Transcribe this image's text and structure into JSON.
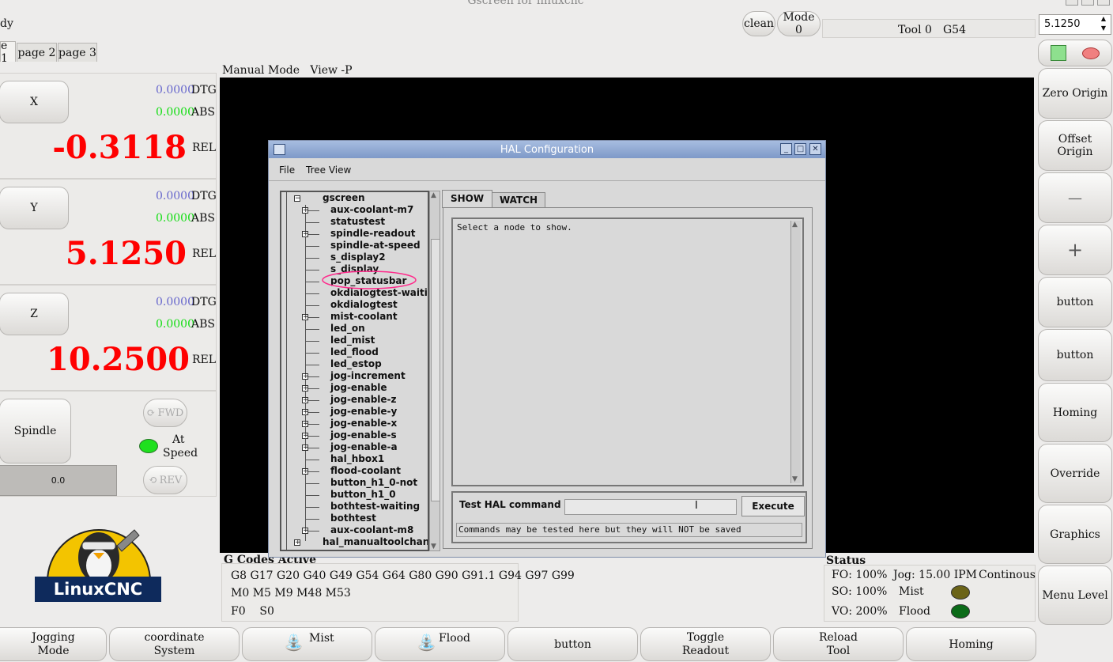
{
  "window_title": "Gscreen for linuxcnc",
  "status_left": "dy",
  "top": {
    "clean_label": "clean",
    "mode_label": "Mode 0",
    "tool_label": "Tool 0",
    "offset_label": "G54",
    "spin_value": "5.1250"
  },
  "tabs": [
    "e 1",
    "page 2",
    "page 3"
  ],
  "axes": [
    {
      "name": "X",
      "dtg": "0.0000",
      "abs": "0.0000",
      "rel": "-0.3118",
      "dtg_label": "DTG",
      "abs_label": "ABS",
      "rel_label": "REL"
    },
    {
      "name": "Y",
      "dtg": "0.0000",
      "abs": "0.0000",
      "rel": "5.1250",
      "dtg_label": "DTG",
      "abs_label": "ABS",
      "rel_label": "REL"
    },
    {
      "name": "Z",
      "dtg": "0.0000",
      "abs": "0.0000",
      "rel": "10.2500",
      "dtg_label": "DTG",
      "abs_label": "ABS",
      "rel_label": "REL"
    }
  ],
  "spindle": {
    "button_label": "Spindle",
    "fwd_label": "FWD",
    "rev_label": "REV",
    "at_label": "At",
    "speed_label": "Speed",
    "speed_value": "0.0"
  },
  "logo_text": "LinuxCNC",
  "graphics_header": "Manual Mode   View -P",
  "gcodes": {
    "title": "G Codes Active",
    "line1": "G8 G17 G20 G40 G49 G54 G64 G80 G90 G91.1 G94 G97 G99",
    "line2": "M0 M5 M9 M48 M53",
    "line3": "F0    S0"
  },
  "status": {
    "title": "Status",
    "fo": "FO: 100%",
    "so": "SO: 100%",
    "vo": "VO: 200%",
    "jog": "Jog: 15.00 IPM",
    "jog_mode": "Continous",
    "mist": "Mist",
    "flood": "Flood",
    "mist_color": "#6b6418",
    "flood_color": "#0b6b18"
  },
  "right_buttons": [
    "Zero Origin",
    "Offset Origin",
    "—",
    "+",
    "button",
    "button",
    "Homing",
    "Override",
    "Graphics",
    "Menu Level"
  ],
  "bottom_buttons": [
    {
      "line1": "Jogging",
      "line2": "Mode"
    },
    {
      "line1": "coordinate",
      "line2": "System"
    },
    {
      "line1": "Mist",
      "line2": ""
    },
    {
      "line1": "Flood",
      "line2": ""
    },
    {
      "line1": "button",
      "line2": ""
    },
    {
      "line1": "Toggle",
      "line2": "Readout"
    },
    {
      "line1": "Reload",
      "line2": "Tool"
    },
    {
      "line1": "Homing",
      "line2": ""
    }
  ],
  "hal": {
    "title": "HAL Configuration",
    "menu_file": "File",
    "menu_tree": "Tree View",
    "tab_show": "SHOW",
    "tab_watch": "WATCH",
    "show_text": "Select a node to show.",
    "test_label": "Test HAL command :",
    "execute_label": "Execute",
    "note": "Commands may be tested here but they will NOT be saved",
    "tree_root": "gscreen",
    "tree_items": [
      "aux-coolant-m7",
      "statustest",
      "spindle-readout",
      "spindle-at-speed",
      "s_display2",
      "s_display",
      "pop_statusbar",
      "okdialogtest-waiting",
      "okdialogtest",
      "mist-coolant",
      "led_on",
      "led_mist",
      "led_flood",
      "led_estop",
      "jog-increment",
      "jog-enable",
      "jog-enable-z",
      "jog-enable-y",
      "jog-enable-x",
      "jog-enable-s",
      "jog-enable-a",
      "hal_hbox1",
      "flood-coolant",
      "button_h1_0-not",
      "button_h1_0",
      "bothtest-waiting",
      "bothtest",
      "aux-coolant-m8"
    ],
    "tree_last": "hal_manualtoolchange"
  }
}
